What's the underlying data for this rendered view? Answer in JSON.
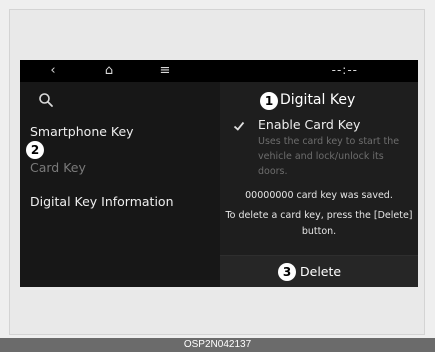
{
  "topbar": {
    "back_glyph": "‹",
    "home_glyph": "⌂",
    "menu_glyph": "≡",
    "clock": "--:--"
  },
  "left_menu": {
    "items": [
      {
        "label": "Smartphone Key",
        "state": "normal"
      },
      {
        "label": "Card Key",
        "state": "disabled"
      },
      {
        "label": "Digital Key Information",
        "state": "normal"
      }
    ]
  },
  "detail": {
    "title": "Digital Key",
    "enable_label": "Enable Card Key",
    "enable_checked": true,
    "enable_desc": "Uses the card key to start the vehicle and lock/unlock its doors.",
    "saved_text": "00000000 card key was saved.",
    "delete_hint": "To delete a card key, press the [Delete] button.",
    "delete_label": "Delete"
  },
  "callouts": [
    "1",
    "2",
    "3"
  ],
  "caption": "OSP2N042137",
  "colors": {
    "screen_bg": "#1e1e1e",
    "left_bg": "#171717",
    "text": "#eeeeee",
    "dim_text": "#6d6d6d",
    "caption_bg": "#6b6b6b"
  }
}
